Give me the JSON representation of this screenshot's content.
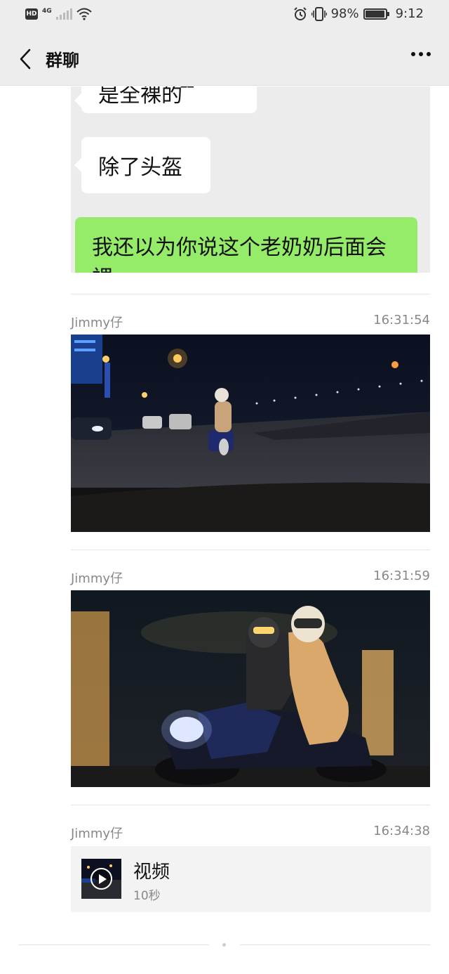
{
  "status_bar": {
    "hd": "HD",
    "network": "4G",
    "battery": "98%",
    "time": "9:12",
    "icons": [
      "signal-icon",
      "wifi-icon",
      "alarm-icon",
      "vibrate-icon",
      "battery-icon"
    ]
  },
  "header": {
    "title": "群聊",
    "back_icon": "chevron-left-icon",
    "more_icon": "more-dots-icon"
  },
  "forwarded_chat": {
    "bubbles": [
      "是全裸的 ̄ ̄",
      "除了头盔",
      "我还以为你说这个老奶奶后面会裸"
    ]
  },
  "messages": [
    {
      "sender": "Jimmy仔",
      "time": "16:31:54",
      "type": "image"
    },
    {
      "sender": "Jimmy仔",
      "time": "16:31:59",
      "type": "image"
    },
    {
      "sender": "Jimmy仔",
      "time": "16:34:38",
      "type": "video",
      "video_label": "视频",
      "duration": "10秒"
    }
  ],
  "colors": {
    "header_bg": "#ededed",
    "bubble_green": "#95ec69",
    "meta_text": "#888888",
    "card_bg": "#f3f3f3"
  }
}
